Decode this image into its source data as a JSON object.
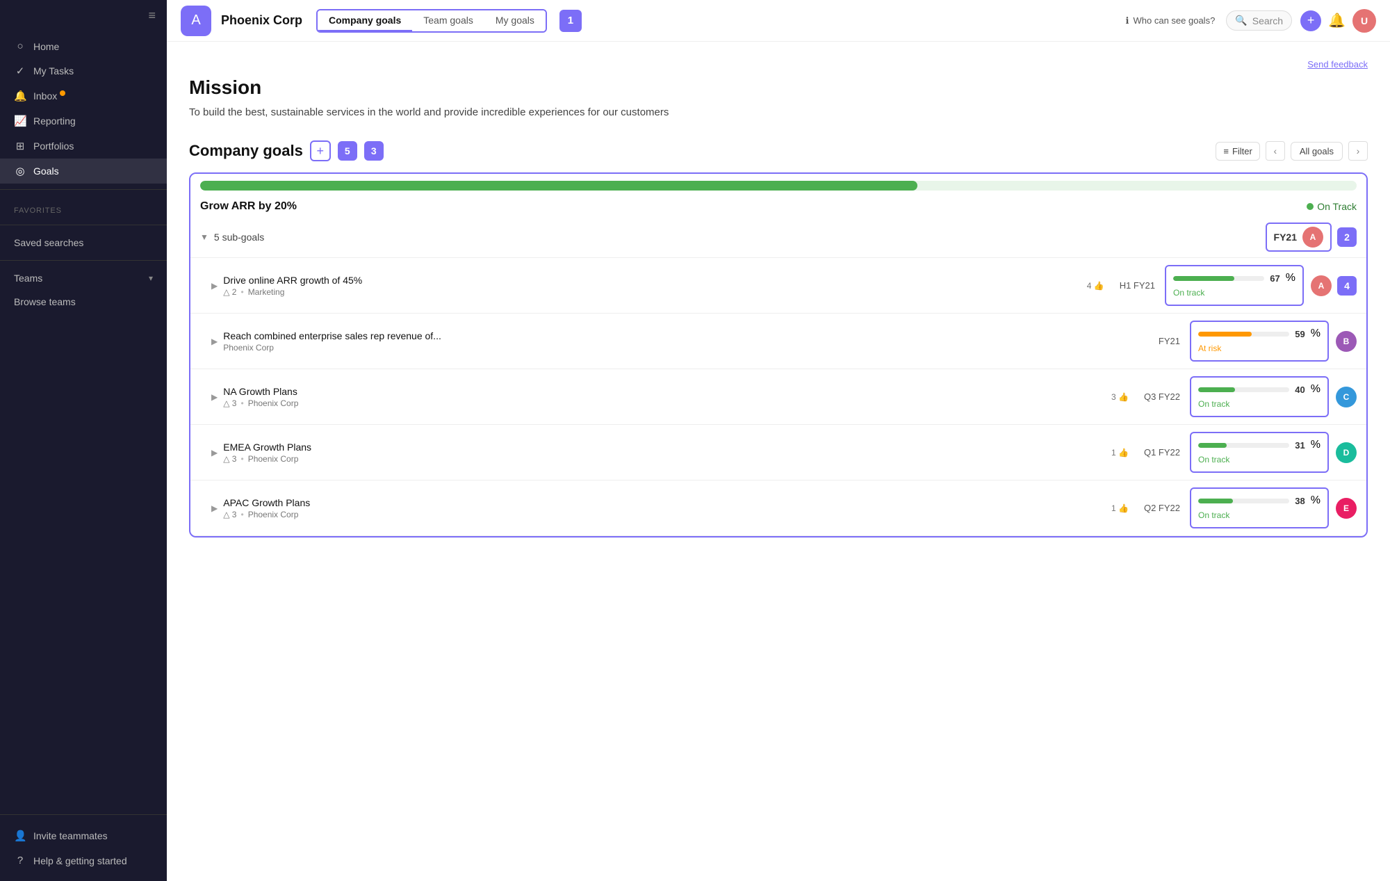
{
  "sidebar": {
    "toggle_icon": "☰",
    "nav_items": [
      {
        "id": "home",
        "icon": "○",
        "label": "Home",
        "active": false
      },
      {
        "id": "my-tasks",
        "icon": "✓",
        "label": "My Tasks",
        "active": false
      },
      {
        "id": "inbox",
        "icon": "🔔",
        "label": "Inbox",
        "badge": true,
        "active": false
      },
      {
        "id": "reporting",
        "icon": "📈",
        "label": "Reporting",
        "active": false
      },
      {
        "id": "portfolios",
        "icon": "⊞",
        "label": "Portfolios",
        "active": false
      },
      {
        "id": "goals",
        "icon": "◎",
        "label": "Goals",
        "active": true
      }
    ],
    "favorites_label": "Favorites",
    "saved_searches_label": "Saved searches",
    "teams_label": "Teams",
    "browse_teams_label": "Browse teams",
    "invite_label": "Invite teammates",
    "help_label": "Help & getting started"
  },
  "header": {
    "company_name": "Phoenix Corp",
    "logo_text": "A",
    "tabs": [
      {
        "id": "company",
        "label": "Company goals",
        "active": true
      },
      {
        "id": "team",
        "label": "Team goals",
        "active": false
      },
      {
        "id": "my",
        "label": "My goals",
        "active": false
      }
    ],
    "step_badge": "1",
    "who_can_see": "Who can see goals?",
    "search_placeholder": "Search",
    "add_icon": "+",
    "feedback_label": "Send feedback"
  },
  "mission": {
    "title": "Mission",
    "text": "To build the best, sustainable services in the world and provide incredible experiences for our customers"
  },
  "goals_section": {
    "title": "Company goals",
    "count_badge": "5",
    "step_badge": "3",
    "filter_label": "Filter",
    "all_goals_label": "All goals",
    "main_goal": {
      "name": "Grow ARR by 20%",
      "progress_pct": 62,
      "status": "On Track",
      "period": "FY21",
      "subgoal_count": "5 sub-goals",
      "step_badge": "2"
    },
    "subgoals": [
      {
        "name": "Drive online ARR growth of 45%",
        "likes": "4",
        "warnings": "2",
        "period": "H1 FY21",
        "owner_tag": "Marketing",
        "pct": 67,
        "bar_color": "green",
        "status": "On track",
        "step_badge": "4",
        "avatar_color": "av-red"
      },
      {
        "name": "Reach combined enterprise sales rep revenue of...",
        "likes": "",
        "warnings": "",
        "period": "FY21",
        "owner_tag": "Phoenix Corp",
        "pct": 59,
        "bar_color": "orange",
        "status": "At risk",
        "step_badge": "",
        "avatar_color": "av-purple"
      },
      {
        "name": "NA Growth Plans",
        "likes": "3",
        "warnings": "3",
        "period": "Q3 FY22",
        "owner_tag": "Phoenix Corp",
        "pct": 40,
        "bar_color": "green",
        "status": "On track",
        "step_badge": "",
        "avatar_color": "av-blue"
      },
      {
        "name": "EMEA Growth Plans",
        "likes": "1",
        "warnings": "3",
        "period": "Q1 FY22",
        "owner_tag": "Phoenix Corp",
        "pct": 31,
        "bar_color": "green",
        "status": "On track",
        "step_badge": "",
        "avatar_color": "av-teal"
      },
      {
        "name": "APAC Growth Plans",
        "likes": "1",
        "warnings": "3",
        "period": "Q2 FY22",
        "owner_tag": "Phoenix Corp",
        "pct": 38,
        "bar_color": "green",
        "status": "On track",
        "step_badge": "",
        "avatar_color": "av-pink"
      }
    ]
  }
}
